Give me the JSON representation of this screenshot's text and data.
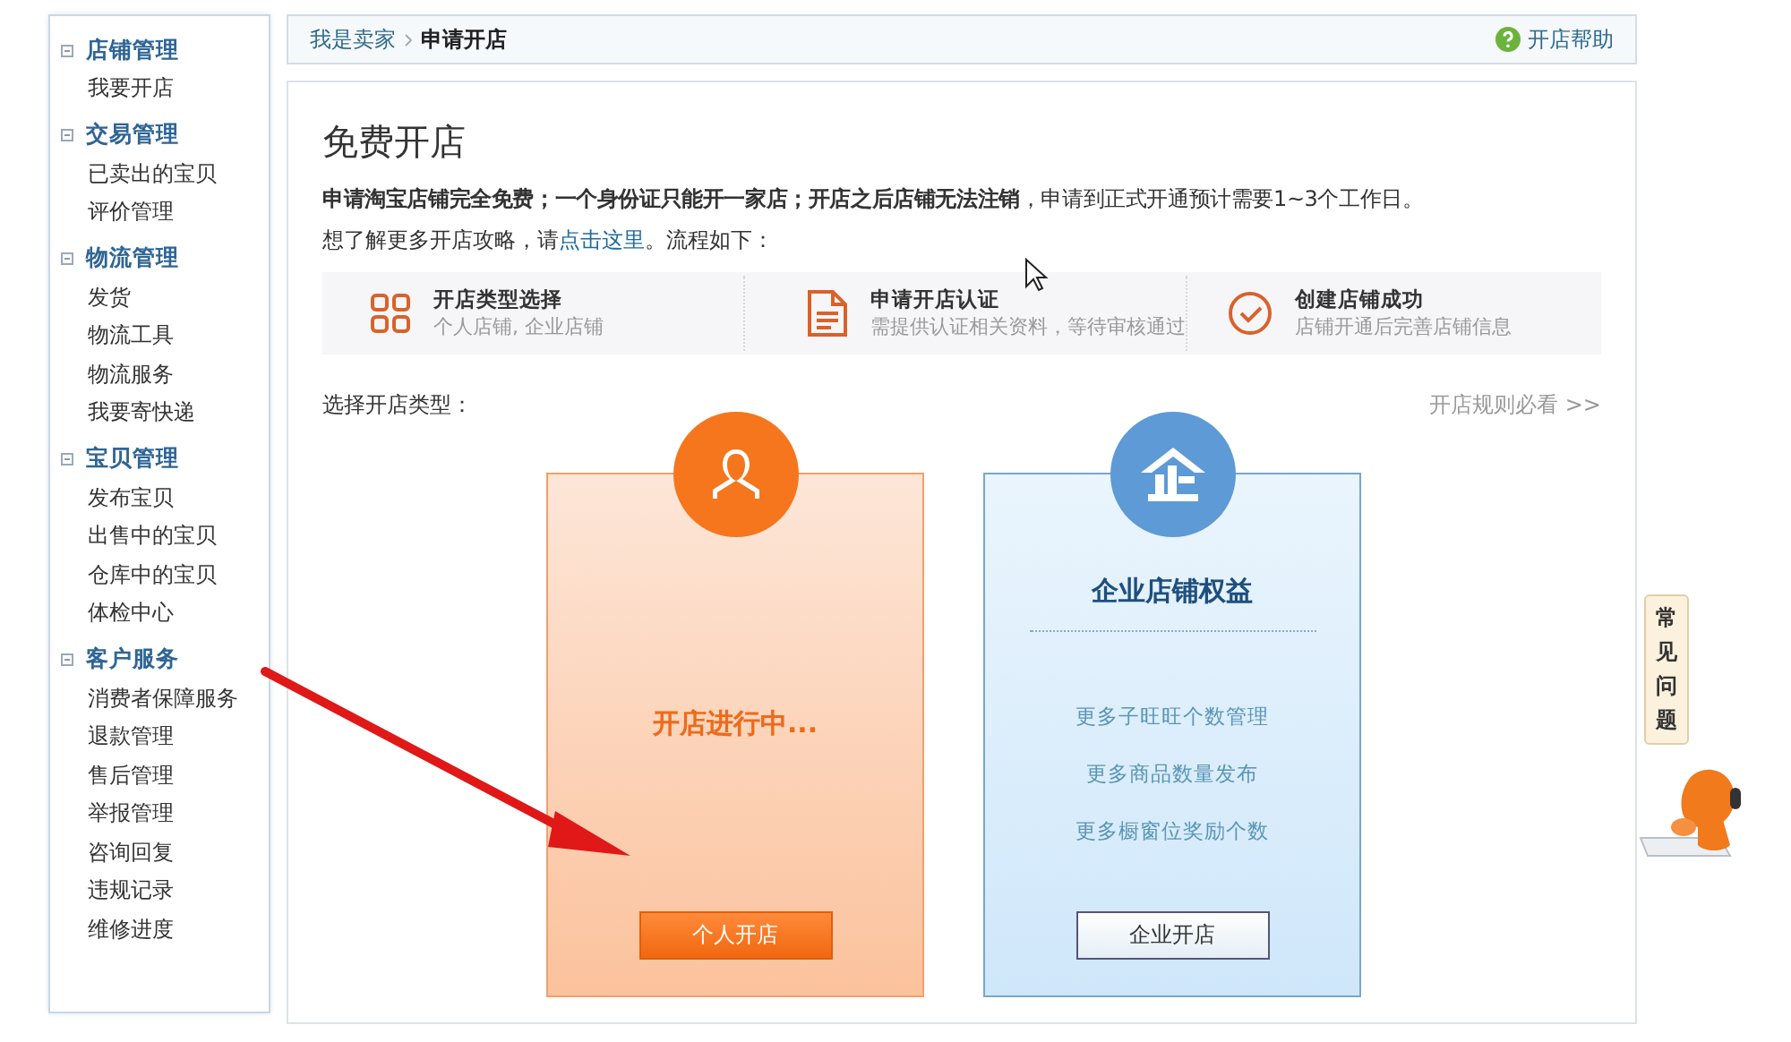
{
  "sidebar": {
    "groups": [
      {
        "title": "店铺管理",
        "expanded": true,
        "items": [
          "我要开店"
        ]
      },
      {
        "title": "交易管理",
        "expanded": true,
        "items": [
          "已卖出的宝贝",
          "评价管理"
        ]
      },
      {
        "title": "物流管理",
        "expanded": true,
        "items": [
          "发货",
          "物流工具",
          "物流服务",
          "我要寄快递"
        ]
      },
      {
        "title": "宝贝管理",
        "expanded": true,
        "items": [
          "发布宝贝",
          "出售中的宝贝",
          "仓库中的宝贝",
          "体检中心"
        ]
      },
      {
        "title": "客户服务",
        "expanded": true,
        "items": [
          "消费者保障服务",
          "退款管理",
          "售后管理",
          "举报管理",
          "咨询回复",
          "违规记录",
          "维修进度"
        ]
      }
    ]
  },
  "breadcrumb": {
    "items": [
      "我是卖家",
      "申请开店"
    ],
    "help": "开店帮助"
  },
  "main": {
    "title": "免费开店",
    "intro": "**申请淘宝店铺完全免费；一个身份证只能开一家店；开店之后店铺无法注销**，申请到正式开通预计需要1~3个工作日。",
    "guide": {
      "prefix": "想了解更多开店攻略，请",
      "link": "点击这里",
      "suffix": "。流程如下："
    },
    "steps": [
      {
        "title": "开店类型选择",
        "desc": "个人店铺, 企业店铺"
      },
      {
        "title": "申请开店认证",
        "desc": "需提供认证相关资料，等待审核通过"
      },
      {
        "title": "创建店铺成功",
        "desc": "店铺开通后完善店铺信息"
      }
    ],
    "choose_label": "选择开店类型：",
    "rules_link": "开店规则必看 >>",
    "cards": [
      {
        "kind": "personal",
        "status": "开店进行中...",
        "button": "个人开店"
      },
      {
        "kind": "enterprise",
        "title": "企业店铺权益",
        "benefits": [
          "更多子旺旺个数管理",
          "更多商品数量发布",
          "更多橱窗位奖励个数"
        ],
        "button": "企业开店"
      }
    ]
  },
  "faq_tab": "常见问题"
}
